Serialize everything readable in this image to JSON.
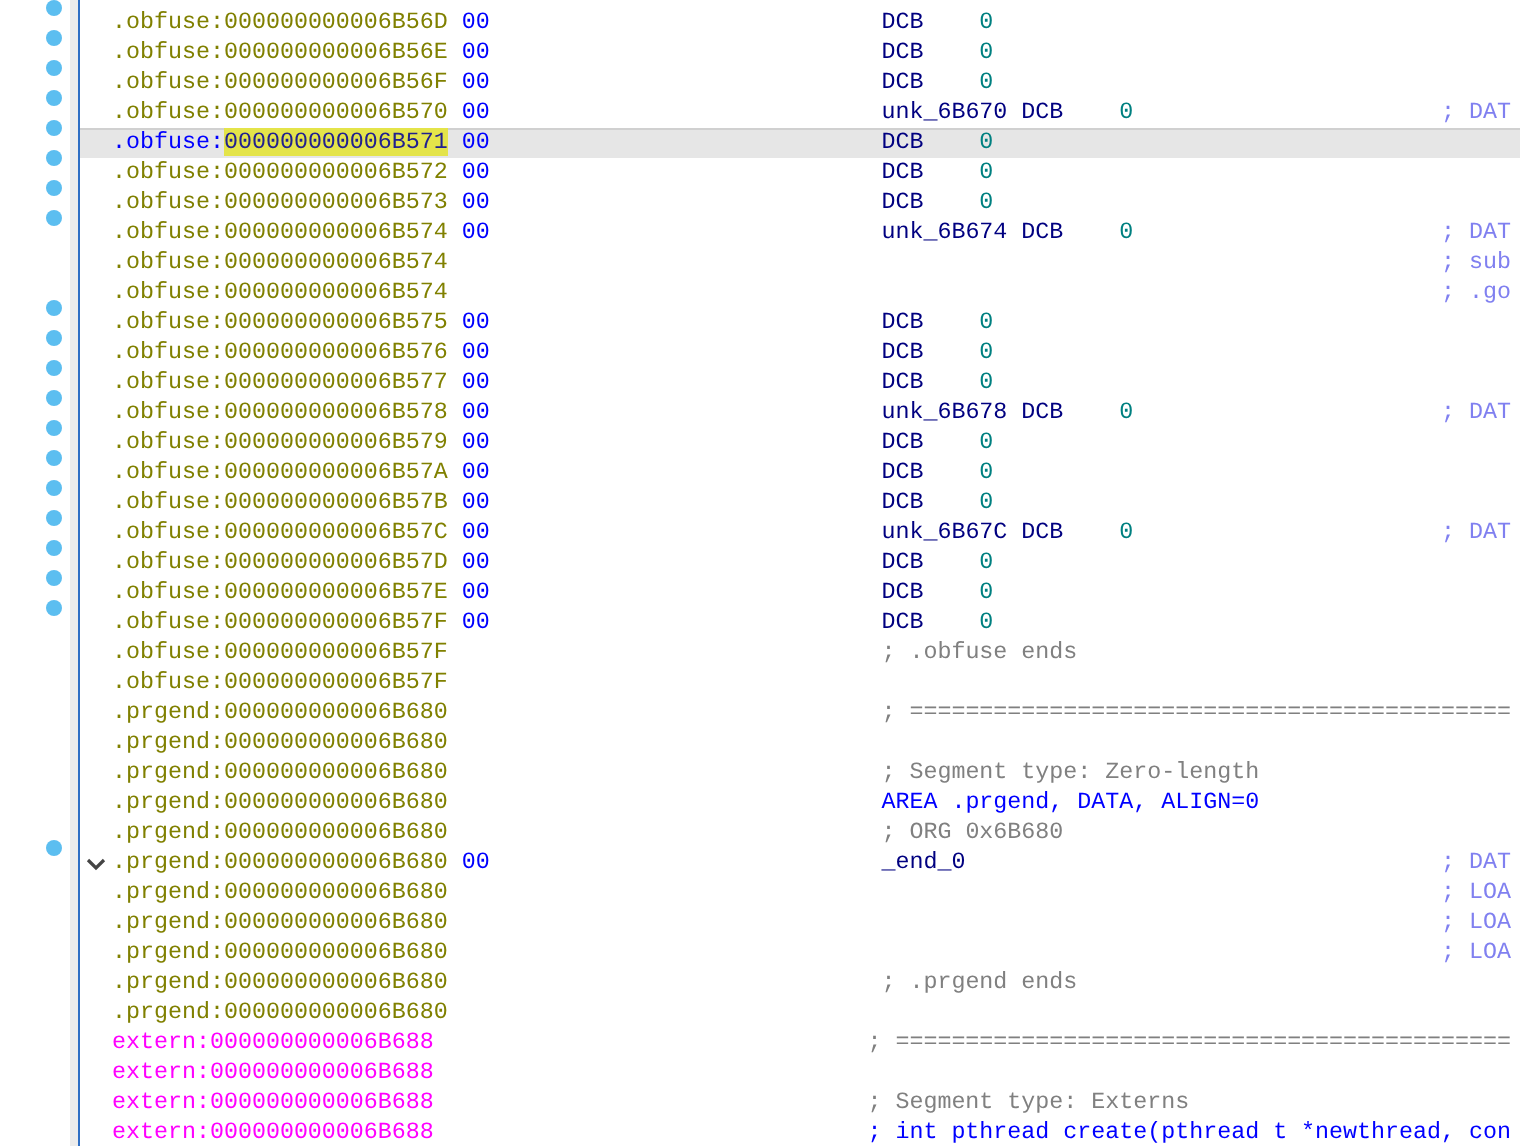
{
  "listing": {
    "rows": [
      {
        "segment": ".obfuse:",
        "address": "000000000006B56D",
        "bytes": "00",
        "code": [
          {
            "kind": "mnemonic",
            "text": "DCB"
          },
          {
            "kind": "number",
            "text": "0"
          }
        ],
        "marked": true,
        "selected": false
      },
      {
        "segment": ".obfuse:",
        "address": "000000000006B56E",
        "bytes": "00",
        "code": [
          {
            "kind": "mnemonic",
            "text": "DCB"
          },
          {
            "kind": "number",
            "text": "0"
          }
        ],
        "marked": true,
        "selected": false
      },
      {
        "segment": ".obfuse:",
        "address": "000000000006B56F",
        "bytes": "00",
        "code": [
          {
            "kind": "mnemonic",
            "text": "DCB"
          },
          {
            "kind": "number",
            "text": "0"
          }
        ],
        "marked": true,
        "selected": false
      },
      {
        "segment": ".obfuse:",
        "address": "000000000006B570",
        "bytes": "00",
        "code": [
          {
            "kind": "label",
            "text": "unk_6B670"
          },
          {
            "kind": "mnemonic",
            "text": "DCB"
          },
          {
            "kind": "number",
            "text": "0"
          }
        ],
        "comment": "; DAT",
        "marked": true,
        "selected": false
      },
      {
        "segment": ".obfuse:",
        "address": "000000000006B571",
        "bytes": "00",
        "code": [
          {
            "kind": "mnemonic",
            "text": "DCB"
          },
          {
            "kind": "number",
            "text": "0"
          }
        ],
        "marked": true,
        "selected": true
      },
      {
        "segment": ".obfuse:",
        "address": "000000000006B572",
        "bytes": "00",
        "code": [
          {
            "kind": "mnemonic",
            "text": "DCB"
          },
          {
            "kind": "number",
            "text": "0"
          }
        ],
        "marked": true,
        "selected": false
      },
      {
        "segment": ".obfuse:",
        "address": "000000000006B573",
        "bytes": "00",
        "code": [
          {
            "kind": "mnemonic",
            "text": "DCB"
          },
          {
            "kind": "number",
            "text": "0"
          }
        ],
        "marked": true,
        "selected": false
      },
      {
        "segment": ".obfuse:",
        "address": "000000000006B574",
        "bytes": "00",
        "code": [
          {
            "kind": "label",
            "text": "unk_6B674"
          },
          {
            "kind": "mnemonic",
            "text": "DCB"
          },
          {
            "kind": "number",
            "text": "0"
          }
        ],
        "comment": "; DAT",
        "marked": true,
        "selected": false
      },
      {
        "segment": ".obfuse:",
        "address": "000000000006B574",
        "comment": "; sub",
        "marked": false,
        "selected": false
      },
      {
        "segment": ".obfuse:",
        "address": "000000000006B574",
        "comment": "; .go",
        "marked": false,
        "selected": false
      },
      {
        "segment": ".obfuse:",
        "address": "000000000006B575",
        "bytes": "00",
        "code": [
          {
            "kind": "mnemonic",
            "text": "DCB"
          },
          {
            "kind": "number",
            "text": "0"
          }
        ],
        "marked": true,
        "selected": false
      },
      {
        "segment": ".obfuse:",
        "address": "000000000006B576",
        "bytes": "00",
        "code": [
          {
            "kind": "mnemonic",
            "text": "DCB"
          },
          {
            "kind": "number",
            "text": "0"
          }
        ],
        "marked": true,
        "selected": false
      },
      {
        "segment": ".obfuse:",
        "address": "000000000006B577",
        "bytes": "00",
        "code": [
          {
            "kind": "mnemonic",
            "text": "DCB"
          },
          {
            "kind": "number",
            "text": "0"
          }
        ],
        "marked": true,
        "selected": false
      },
      {
        "segment": ".obfuse:",
        "address": "000000000006B578",
        "bytes": "00",
        "code": [
          {
            "kind": "label",
            "text": "unk_6B678"
          },
          {
            "kind": "mnemonic",
            "text": "DCB"
          },
          {
            "kind": "number",
            "text": "0"
          }
        ],
        "comment": "; DAT",
        "marked": true,
        "selected": false
      },
      {
        "segment": ".obfuse:",
        "address": "000000000006B579",
        "bytes": "00",
        "code": [
          {
            "kind": "mnemonic",
            "text": "DCB"
          },
          {
            "kind": "number",
            "text": "0"
          }
        ],
        "marked": true,
        "selected": false
      },
      {
        "segment": ".obfuse:",
        "address": "000000000006B57A",
        "bytes": "00",
        "code": [
          {
            "kind": "mnemonic",
            "text": "DCB"
          },
          {
            "kind": "number",
            "text": "0"
          }
        ],
        "marked": true,
        "selected": false
      },
      {
        "segment": ".obfuse:",
        "address": "000000000006B57B",
        "bytes": "00",
        "code": [
          {
            "kind": "mnemonic",
            "text": "DCB"
          },
          {
            "kind": "number",
            "text": "0"
          }
        ],
        "marked": true,
        "selected": false
      },
      {
        "segment": ".obfuse:",
        "address": "000000000006B57C",
        "bytes": "00",
        "code": [
          {
            "kind": "label",
            "text": "unk_6B67C"
          },
          {
            "kind": "mnemonic",
            "text": "DCB"
          },
          {
            "kind": "number",
            "text": "0"
          }
        ],
        "comment": "; DAT",
        "marked": true,
        "selected": false
      },
      {
        "segment": ".obfuse:",
        "address": "000000000006B57D",
        "bytes": "00",
        "code": [
          {
            "kind": "mnemonic",
            "text": "DCB"
          },
          {
            "kind": "number",
            "text": "0"
          }
        ],
        "marked": true,
        "selected": false
      },
      {
        "segment": ".obfuse:",
        "address": "000000000006B57E",
        "bytes": "00",
        "code": [
          {
            "kind": "mnemonic",
            "text": "DCB"
          },
          {
            "kind": "number",
            "text": "0"
          }
        ],
        "marked": true,
        "selected": false
      },
      {
        "segment": ".obfuse:",
        "address": "000000000006B57F",
        "bytes": "00",
        "code": [
          {
            "kind": "mnemonic",
            "text": "DCB"
          },
          {
            "kind": "number",
            "text": "0"
          }
        ],
        "marked": true,
        "selected": false
      },
      {
        "segment": ".obfuse:",
        "address": "000000000006B57F",
        "code": [
          {
            "kind": "comment",
            "text": "; .obfuse ends"
          }
        ],
        "marked": false,
        "selected": false
      },
      {
        "segment": ".obfuse:",
        "address": "000000000006B57F",
        "marked": false,
        "selected": false
      },
      {
        "segment": ".prgend:",
        "address": "000000000006B680",
        "code": [
          {
            "kind": "comment",
            "text": "; ==========================================="
          }
        ],
        "marked": false,
        "selected": false
      },
      {
        "segment": ".prgend:",
        "address": "000000000006B680",
        "marked": false,
        "selected": false
      },
      {
        "segment": ".prgend:",
        "address": "000000000006B680",
        "code": [
          {
            "kind": "comment",
            "text": "; Segment type: Zero-length"
          }
        ],
        "marked": false,
        "selected": false
      },
      {
        "segment": ".prgend:",
        "address": "000000000006B680",
        "code": [
          {
            "kind": "directive",
            "text": "AREA .prgend, DATA, ALIGN=0"
          }
        ],
        "marked": false,
        "selected": false
      },
      {
        "segment": ".prgend:",
        "address": "000000000006B680",
        "code": [
          {
            "kind": "comment",
            "text": "; ORG 0x6B680"
          }
        ],
        "marked": false,
        "selected": false
      },
      {
        "segment": ".prgend:",
        "address": "000000000006B680",
        "bytes": "00",
        "code": [
          {
            "kind": "name",
            "text": "_end_0"
          }
        ],
        "comment": "; DAT",
        "marked": true,
        "selected": false,
        "expanded": true
      },
      {
        "segment": ".prgend:",
        "address": "000000000006B680",
        "comment": "; LOA",
        "marked": false,
        "selected": false
      },
      {
        "segment": ".prgend:",
        "address": "000000000006B680",
        "comment": "; LOA",
        "marked": false,
        "selected": false
      },
      {
        "segment": ".prgend:",
        "address": "000000000006B680",
        "comment": "; LOA",
        "marked": false,
        "selected": false
      },
      {
        "segment": ".prgend:",
        "address": "000000000006B680",
        "code": [
          {
            "kind": "comment",
            "text": "; .prgend ends"
          }
        ],
        "marked": false,
        "selected": false
      },
      {
        "segment": ".prgend:",
        "address": "000000000006B680",
        "marked": false,
        "selected": false
      },
      {
        "segment": "extern:",
        "address": "000000000006B688",
        "code": [
          {
            "kind": "comment",
            "text": "; ============================================"
          }
        ],
        "marked": false,
        "selected": false
      },
      {
        "segment": "extern:",
        "address": "000000000006B688",
        "marked": false,
        "selected": false
      },
      {
        "segment": "extern:",
        "address": "000000000006B688",
        "code": [
          {
            "kind": "comment",
            "text": "; Segment type: Externs"
          }
        ],
        "marked": false,
        "selected": false
      },
      {
        "segment": "extern:",
        "address": "000000000006B688",
        "code": [
          {
            "kind": "declaration",
            "text": "; int pthread create(pthread t *newthread, con"
          }
        ],
        "marked": false,
        "selected": false
      }
    ]
  }
}
